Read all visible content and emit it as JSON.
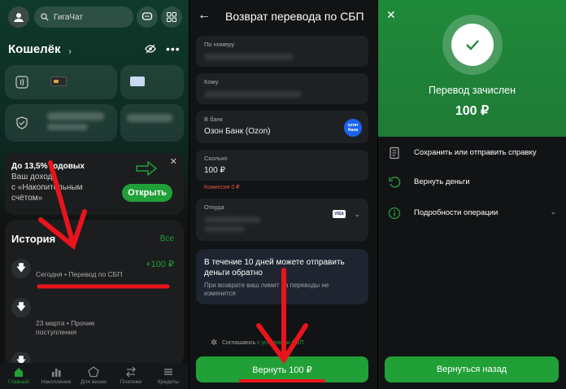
{
  "panel1": {
    "search_label": "ГигаЧат",
    "wallet_title": "Кошелёк",
    "promo": {
      "line1": "До 13,5% годовых",
      "line2": "Ваш доход",
      "line3": "с «Накопительным",
      "line4": "счётом»",
      "button": "Открыть"
    },
    "history": {
      "title": "История",
      "all_link": "Все",
      "items": [
        {
          "amount": "+100 ₽",
          "subtitle": "Сегодня • Перевод по СБП"
        },
        {
          "subtitle_line1": "23 марта • Прочие",
          "subtitle_line2": "поступления"
        }
      ]
    },
    "tabs": [
      "Главный",
      "Накопления",
      "Для жизни",
      "Платежи",
      "Кредиты"
    ]
  },
  "panel2": {
    "title": "Возврат перевода по СБП",
    "fields": {
      "phone_label": "По номеру",
      "to_label": "Кому",
      "bank_label": "В банк",
      "bank_value": "Озон Банк (Ozon)",
      "bank_logo": "ozon банк",
      "amount_label": "Сколько",
      "amount_value": "100 ₽",
      "fee": "Комиссия 0 ₽",
      "from_label": "Откуда",
      "card_brand": "VISA"
    },
    "info": {
      "title": "В течение 10 дней можете отправить деньги обратно",
      "subtitle": "При возврате ваш лимит на переводы не изменится"
    },
    "agreement_prefix": "Соглашаюсь",
    "agreement_link": "с условиями СБП",
    "button": "Вернуть 100 ₽"
  },
  "panel3": {
    "status": "Перевод зачислен",
    "amount": "100 ₽",
    "actions": [
      {
        "label": "Сохранить или отправить справку",
        "icon": "document-icon"
      },
      {
        "label": "Вернуть деньги",
        "icon": "return-icon"
      },
      {
        "label": "Подробности операции",
        "icon": "info-icon"
      }
    ],
    "button": "Вернуться назад"
  },
  "colors": {
    "accent": "#21a038",
    "annotation": "#e8141c",
    "fee_text": "#e5553b"
  }
}
